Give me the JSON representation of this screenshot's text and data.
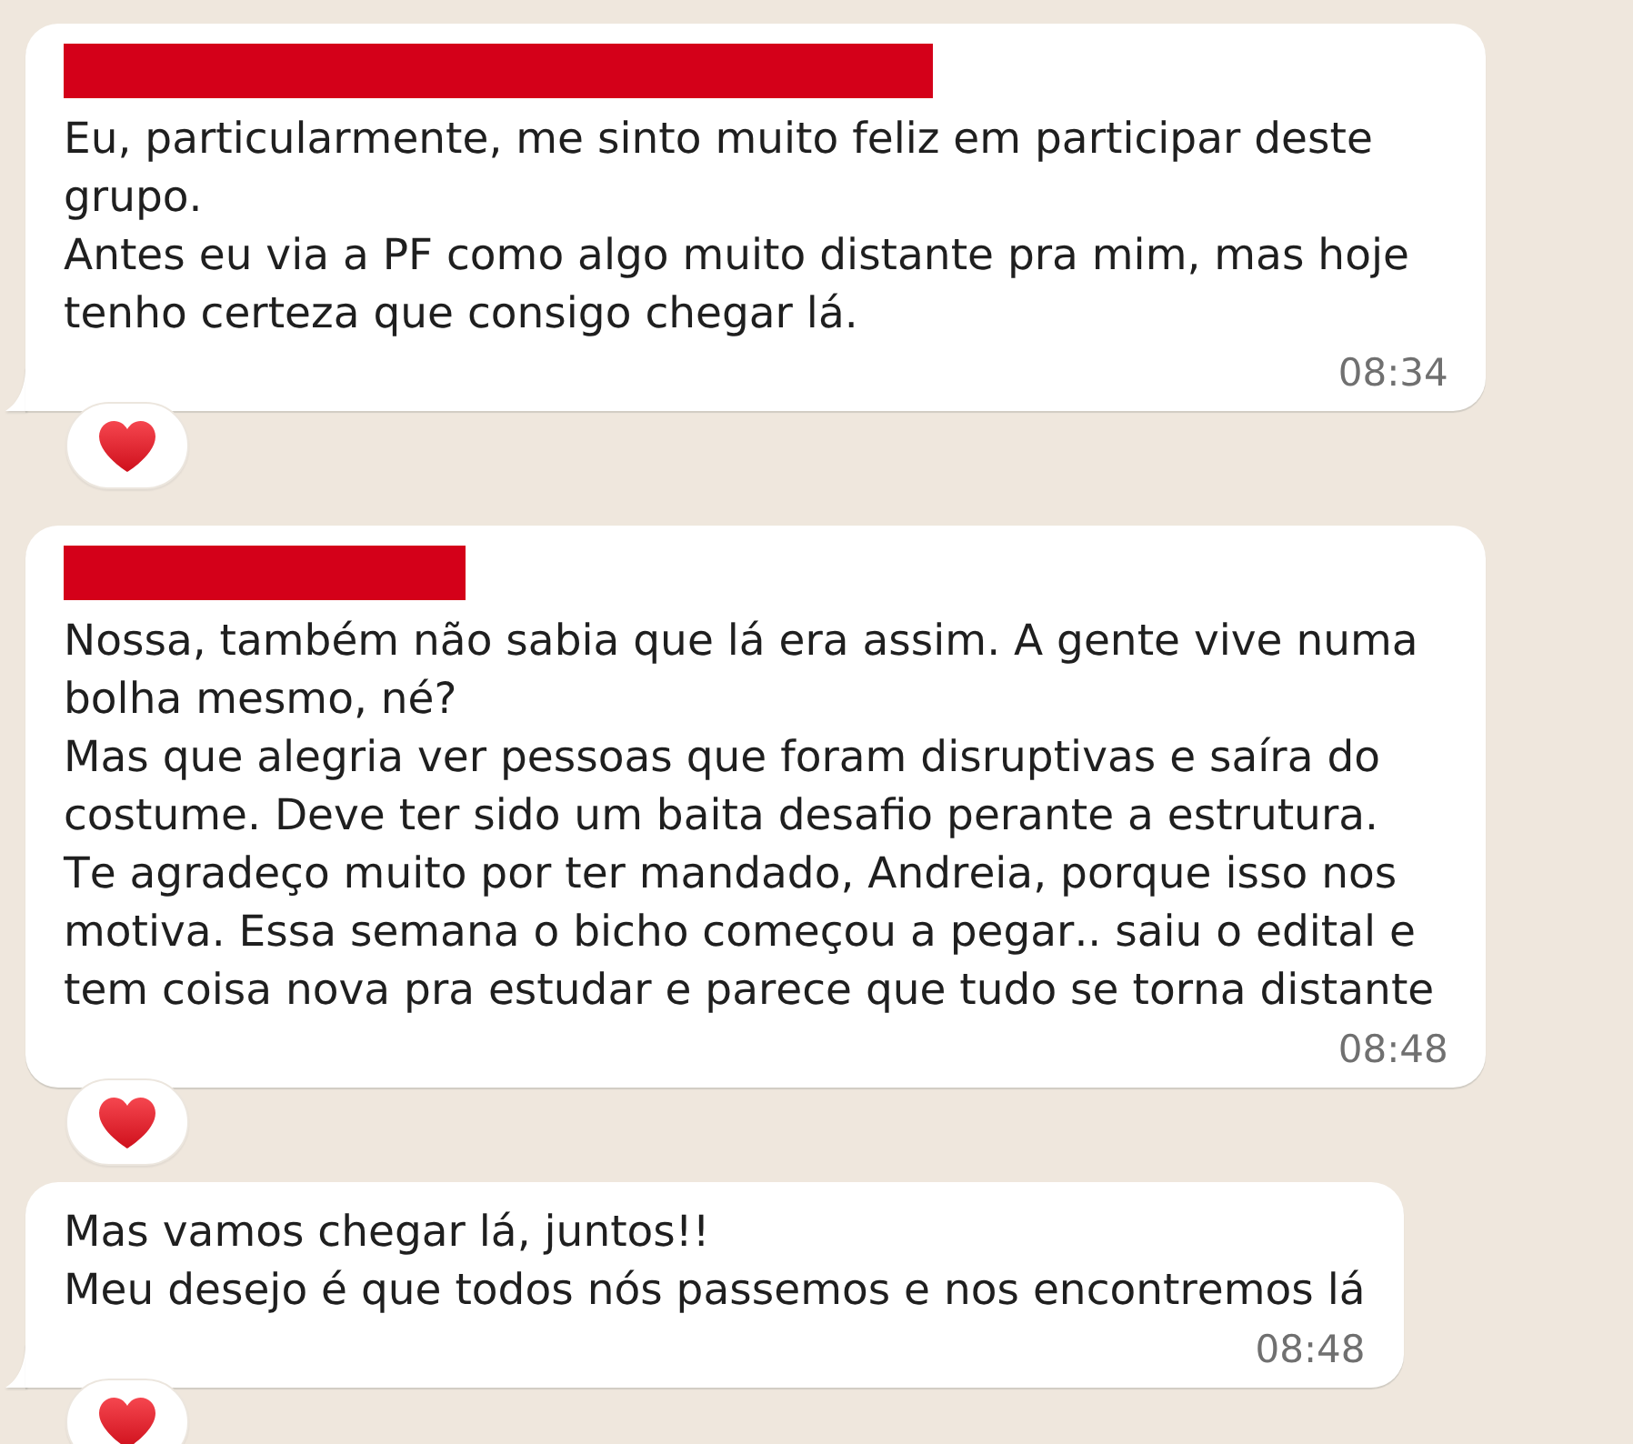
{
  "messages": [
    {
      "sender_redacted": true,
      "tail": true,
      "text": "Eu, particularmente, me sinto muito feliz em participar deste grupo.\nAntes eu via a PF como algo muito distante pra mim, mas hoje tenho certeza que consigo chegar lá.",
      "time": "08:34",
      "has_reaction": true
    },
    {
      "sender_redacted": true,
      "tail": false,
      "text": "Nossa, também não sabia que lá era assim. A gente vive numa bolha mesmo, né?\nMas que alegria ver pessoas que foram disruptivas e saíra do costume. Deve ter sido um baita desafio perante a estrutura.\nTe agradeço muito por ter mandado, Andreia, porque isso nos motiva. Essa semana o bicho começou a pegar.. saiu o edital e tem coisa nova pra estudar e parece que tudo se torna distante",
      "time": "08:48",
      "has_reaction": true
    },
    {
      "sender_redacted": false,
      "tail": true,
      "text": "Mas vamos chegar lá, juntos!!\nMeu desejo é que todos nós passemos e nos encontremos lá",
      "time": "08:48",
      "has_reaction": true
    }
  ]
}
